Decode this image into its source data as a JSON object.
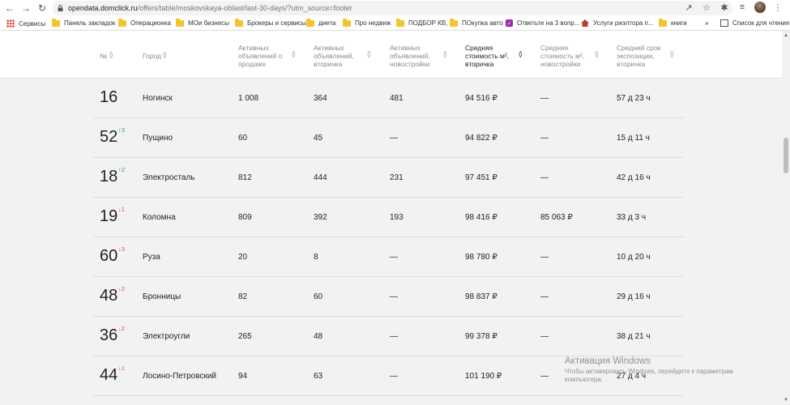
{
  "browser": {
    "url_host": "opendata.domclick.ru",
    "url_path": "/offers/table/moskovskaya-oblast/last-30-days/?utm_source=footer"
  },
  "bookmarks": [
    {
      "label": "Сервисы",
      "icon": "apps-grid-icon"
    },
    {
      "label": "Панель закладок",
      "icon": "folder-icon"
    },
    {
      "label": "Операционка",
      "icon": "folder-icon"
    },
    {
      "label": "МОи бизнесы",
      "icon": "folder-icon"
    },
    {
      "label": "Брокеры и сервисы",
      "icon": "folder-icon"
    },
    {
      "label": "диета",
      "icon": "folder-icon"
    },
    {
      "label": "Про недвиж",
      "icon": "folder-icon"
    },
    {
      "label": "ПОДБОР КВ,",
      "icon": "folder-icon"
    },
    {
      "label": "ПОкупка авто",
      "icon": "folder-icon"
    },
    {
      "label": "Ответьте на 3 вопр...",
      "icon": "check-icon"
    },
    {
      "label": "Услуги риэлтора п...",
      "icon": "house-icon"
    },
    {
      "label": "книги",
      "icon": "folder-icon"
    },
    {
      "label": "»",
      "icon": ""
    },
    {
      "label": "Список для чтения",
      "icon": "reading-list-icon"
    }
  ],
  "table": {
    "headers": [
      {
        "label": "№",
        "lines": [
          "№"
        ]
      },
      {
        "label": "Город",
        "lines": [
          "Город"
        ]
      },
      {
        "label": "Активных объявлений о продаже",
        "lines": [
          "Активных",
          "объявлений о",
          "продаже"
        ]
      },
      {
        "label": "Активных объявлений, вторичка",
        "lines": [
          "Активных",
          "объявлений,",
          "вторичка"
        ]
      },
      {
        "label": "Активных объявлений, новостройки",
        "lines": [
          "Активных",
          "объявлений,",
          "новостройки"
        ]
      },
      {
        "label": "Средняя стоимость м², вторичка",
        "lines": [
          "Средняя",
          "стоимость м²,",
          "вторичка"
        ],
        "active": true
      },
      {
        "label": "Средняя стоимость м², новостройки",
        "lines": [
          "Средняя",
          "стоимость м²,",
          "новостройки"
        ]
      },
      {
        "label": "Средний срок экспозиции, вторичка",
        "lines": [
          "Средний срок",
          "экспозиции,",
          "вторичка"
        ]
      }
    ],
    "rows": [
      {
        "rank": "16",
        "delta": "",
        "dir": "",
        "city": "Ногинск",
        "total": "1 008",
        "secondary": "364",
        "new": "481",
        "price_sec": "94 516 ₽",
        "price_new": "—",
        "exposure": "57 д 23 ч"
      },
      {
        "rank": "52",
        "delta": "3",
        "dir": "up",
        "city": "Пущино",
        "total": "60",
        "secondary": "45",
        "new": "—",
        "price_sec": "94 822 ₽",
        "price_new": "—",
        "exposure": "15 д 11 ч"
      },
      {
        "rank": "18",
        "delta": "2",
        "dir": "up",
        "city": "Электросталь",
        "total": "812",
        "secondary": "444",
        "new": "231",
        "price_sec": "97 451 ₽",
        "price_new": "—",
        "exposure": "42 д 16 ч"
      },
      {
        "rank": "19",
        "delta": "1",
        "dir": "down",
        "city": "Коломна",
        "total": "809",
        "secondary": "392",
        "new": "193",
        "price_sec": "98 416 ₽",
        "price_new": "85 063 ₽",
        "exposure": "33 д 3 ч"
      },
      {
        "rank": "60",
        "delta": "3",
        "dir": "down",
        "city": "Руза",
        "total": "20",
        "secondary": "8",
        "new": "—",
        "price_sec": "98 780 ₽",
        "price_new": "—",
        "exposure": "10 д 20 ч"
      },
      {
        "rank": "48",
        "delta": "2",
        "dir": "down",
        "city": "Бронницы",
        "total": "82",
        "secondary": "60",
        "new": "—",
        "price_sec": "98 837 ₽",
        "price_new": "—",
        "exposure": "29 д 16 ч"
      },
      {
        "rank": "36",
        "delta": "2",
        "dir": "down",
        "city": "Электроугли",
        "total": "265",
        "secondary": "48",
        "new": "—",
        "price_sec": "99 378 ₽",
        "price_new": "—",
        "exposure": "38 д 21 ч"
      },
      {
        "rank": "44",
        "delta": "1",
        "dir": "down",
        "city": "Лосино-Петровский",
        "total": "94",
        "secondary": "63",
        "new": "—",
        "price_sec": "101 190 ₽",
        "price_new": "—",
        "exposure": "27 д 4 ч"
      }
    ]
  },
  "watermark": {
    "title": "Активация Windows",
    "text": "Чтобы активировать Windows, перейдите к параметрам компьютера."
  },
  "colors": {
    "up": "#2e9f4f",
    "down": "#e5484d"
  }
}
